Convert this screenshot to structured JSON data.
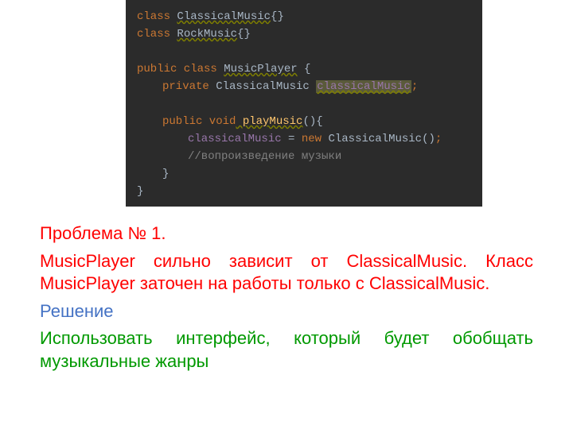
{
  "code": {
    "l1_kw": "class",
    "l1_name": "ClassicalMusic",
    "l1_braces": "{}",
    "l2_kw": "class",
    "l2_name": "RockMusic",
    "l2_braces": "{}",
    "l4_mods": "public class",
    "l4_name": "MusicPlayer",
    "l4_open": " {",
    "l5_mod": "private",
    "l5_type": " ClassicalMusic ",
    "l5_field": "classicalMusic",
    "l5_semi": ";",
    "l7_mods": "public void",
    "l7_name": " playMusic",
    "l7_sig": "(){",
    "l8_field": "classicalMusic",
    "l8_eq": " = ",
    "l8_new": "new",
    "l8_ctor": " ClassicalMusic()",
    "l8_semi": ";",
    "l9_comment": "//вопроизведение музыки",
    "l10_close": "}",
    "l11_close": "}"
  },
  "text": {
    "problem_title": "Проблема № 1.",
    "problem_body": "MusicPlayer сильно зависит от ClassicalMusic. Класс MusicPlayer заточен на работы только с ClassicalMusic.",
    "solution_title": "Решение",
    "solution_body": "Использовать интерфейс, который будет обобщать музыкальные жанры"
  }
}
